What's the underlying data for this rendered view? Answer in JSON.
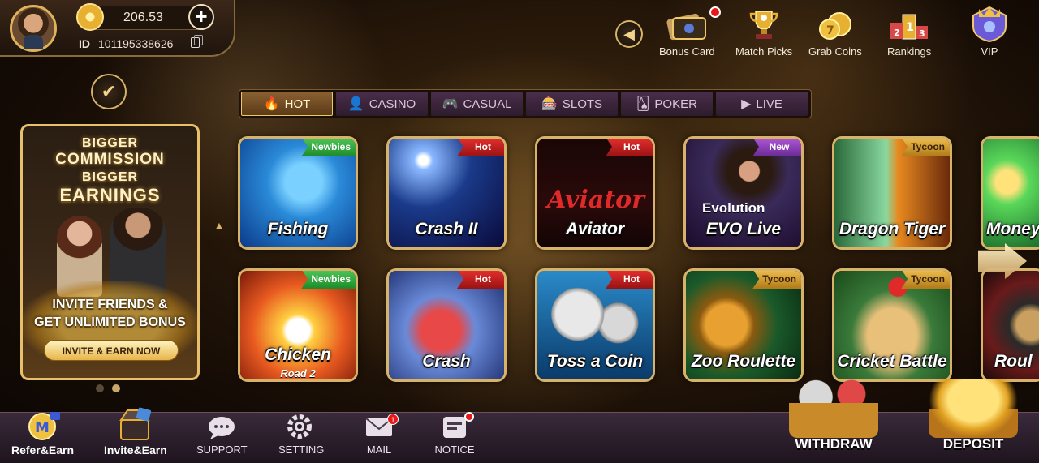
{
  "user": {
    "balance": "206.53",
    "id_label": "ID",
    "id_value": "101195338626"
  },
  "top_nav": [
    {
      "label": "Bonus Card",
      "icon": "bonus-card-icon",
      "has_dot": true
    },
    {
      "label": "Match Picks",
      "icon": "trophy-icon",
      "has_dot": false
    },
    {
      "label": "Grab Coins",
      "icon": "coins-icon",
      "has_dot": false
    },
    {
      "label": "Rankings",
      "icon": "podium-icon",
      "has_dot": false
    },
    {
      "label": "VIP",
      "icon": "vip-badge-icon",
      "has_dot": false
    }
  ],
  "banner": {
    "line1": "BIGGER",
    "line2": "COMMISSION",
    "line3": "BIGGER",
    "line4": "EARNINGS",
    "invite1": "INVITE FRIENDS &",
    "invite2": "GET UNLIMITED BONUS",
    "cta": "INVITE & EARN NOW",
    "slides": 2,
    "active_slide": 2
  },
  "tabs": [
    {
      "label": "HOT",
      "icon": "flame-icon",
      "active": true
    },
    {
      "label": "CASINO",
      "icon": "dealer-icon",
      "active": false
    },
    {
      "label": "CASUAL",
      "icon": "gamepad-icon",
      "active": false
    },
    {
      "label": "SLOTS",
      "icon": "slot-machine-icon",
      "active": false
    },
    {
      "label": "POKER",
      "icon": "cards-icon",
      "active": false
    },
    {
      "label": "LIVE",
      "icon": "video-icon",
      "active": false
    }
  ],
  "games_row1": [
    {
      "name": "Fishing",
      "tag": "Newbies",
      "tag_type": "newbies"
    },
    {
      "name": "Crash II",
      "tag": "Hot",
      "tag_type": "hot"
    },
    {
      "name": "Aviator",
      "tag": "Hot",
      "tag_type": "hot"
    },
    {
      "name": "EVO Live",
      "tag": "New",
      "tag_type": "new",
      "brand": "Evolution"
    },
    {
      "name": "Dragon Tiger",
      "tag": "Tycoon",
      "tag_type": "tycoon"
    },
    {
      "name": "Money",
      "tag": "",
      "tag_type": ""
    }
  ],
  "games_row2": [
    {
      "name": "Chicken",
      "sub": "Road 2",
      "tag": "Newbies",
      "tag_type": "newbies"
    },
    {
      "name": "Crash",
      "tag": "Hot",
      "tag_type": "hot"
    },
    {
      "name": "Toss a Coin",
      "tag": "Hot",
      "tag_type": "hot"
    },
    {
      "name": "Zoo Roulette",
      "tag": "Tycoon",
      "tag_type": "tycoon"
    },
    {
      "name": "Cricket Battle",
      "tag": "Tycoon",
      "tag_type": "tycoon"
    },
    {
      "name": "Roul",
      "tag": "",
      "tag_type": ""
    }
  ],
  "bottom_nav": [
    {
      "label": "Refer&Earn",
      "icon": "refer-earn-icon"
    },
    {
      "label": "Invite&Earn",
      "icon": "invite-chest-icon"
    },
    {
      "label": "SUPPORT",
      "icon": "chat-bubble-icon"
    },
    {
      "label": "SETTING",
      "icon": "gear-icon"
    },
    {
      "label": "MAIL",
      "icon": "mail-icon",
      "badge": "1"
    },
    {
      "label": "NOTICE",
      "icon": "notice-icon",
      "has_dot": true
    }
  ],
  "actions": {
    "withdraw": "WITHDRAW",
    "deposit": "DEPOSIT"
  }
}
